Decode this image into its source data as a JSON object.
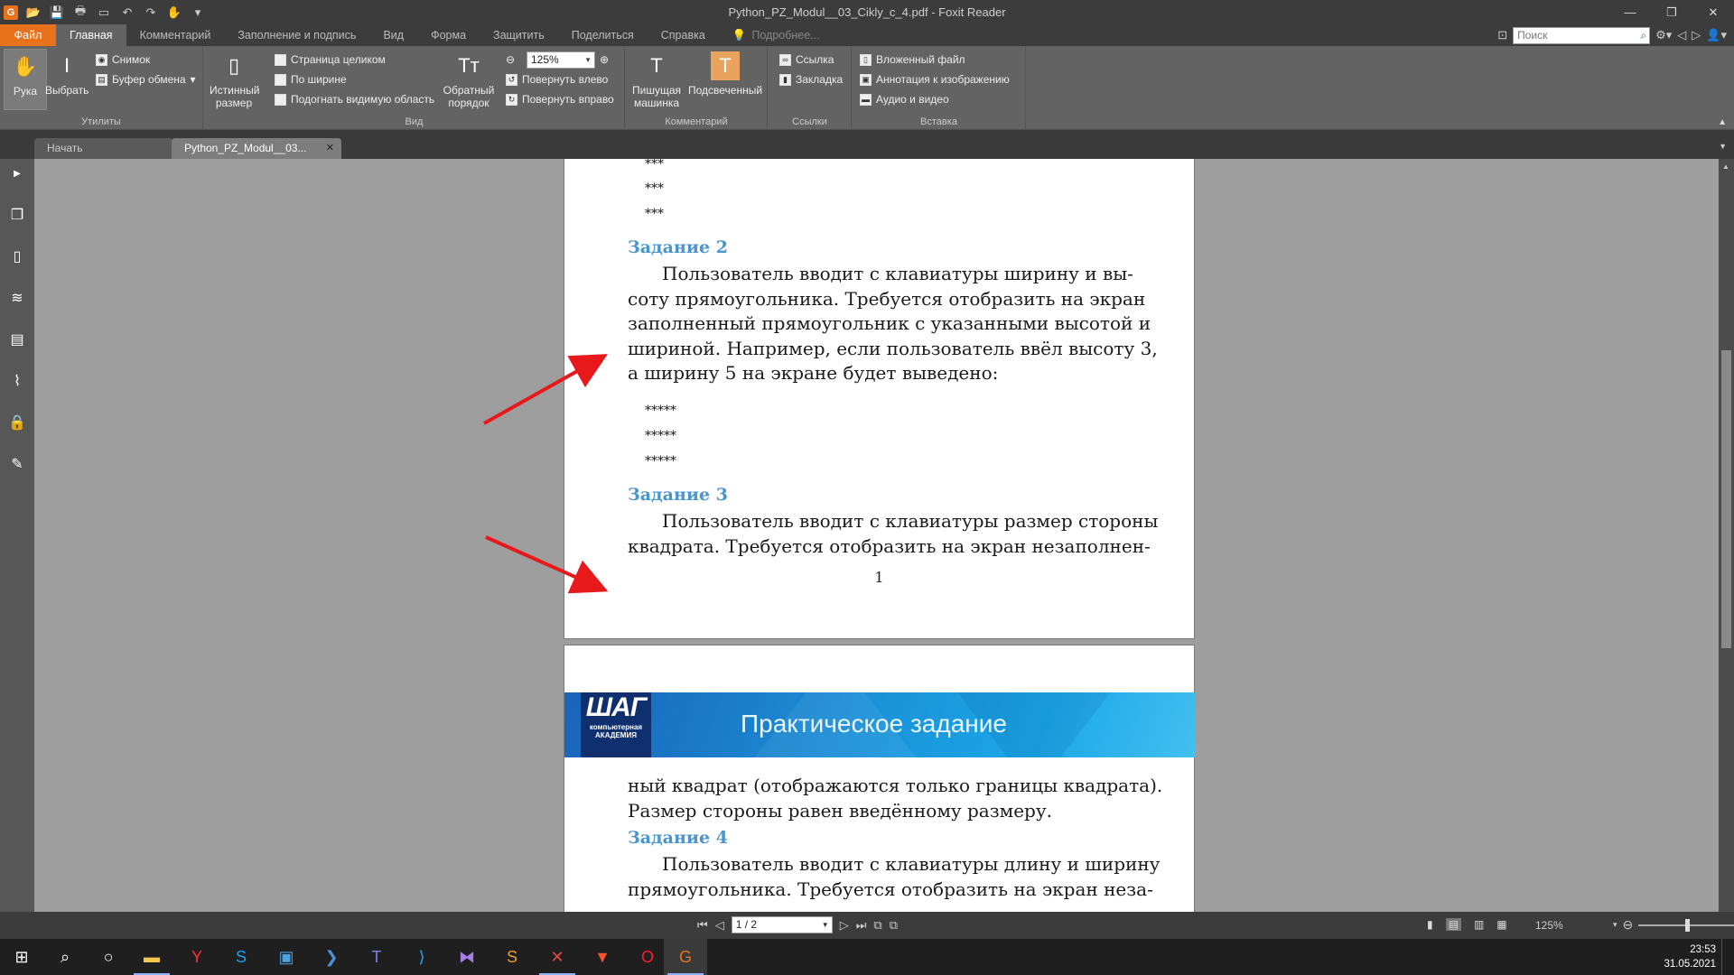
{
  "window": {
    "title": "Python_PZ_Modul__03_Cikly_c_4.pdf - Foxit Reader",
    "app_icon": "G",
    "controls": [
      "—",
      "❐",
      "✕"
    ]
  },
  "ribbon_tabs": [
    "Файл",
    "Главная",
    "Комментарий",
    "Заполнение и подпись",
    "Вид",
    "Форма",
    "Защитить",
    "Поделиться",
    "Справка"
  ],
  "tell_me": "Подробнее...",
  "search": {
    "placeholder": "Поиск"
  },
  "ribbon": {
    "utilities": {
      "label": "Утилиты",
      "hand": "Рука",
      "select": "Выбрать",
      "snapshot": "Снимок",
      "clipboard": "Буфер обмена"
    },
    "view": {
      "label": "Вид",
      "actual_size_1": "Истинный",
      "actual_size_2": "размер",
      "fit_page": "Страница целиком",
      "fit_width": "По ширине",
      "fit_visible": "Подогнать видимую область",
      "reverse_1": "Обратный",
      "reverse_2": "порядок",
      "zoom": "125%",
      "rotate_left": "Повернуть влево",
      "rotate_right": "Повернуть вправо"
    },
    "comment": {
      "label": "Комментарий",
      "typewriter_1": "Пишущая",
      "typewriter_2": "машинка",
      "highlight": "Подсвеченный"
    },
    "links": {
      "label": "Ссылки",
      "link": "Ссылка",
      "bookmark": "Закладка"
    },
    "insert": {
      "label": "Вставка",
      "attachment": "Вложенный файл",
      "image_annotation": "Аннотация к изображению",
      "audio_video": "Аудио и видео"
    }
  },
  "doc_tabs": {
    "start": "Начать",
    "current": "Python_PZ_Modul__03..."
  },
  "document": {
    "stars_top": [
      "***",
      "***",
      "***"
    ],
    "task2_heading": "Задание 2",
    "task2_lines": [
      "Пользователь вводит с клавиатуры ширину и вы-",
      "соту прямоугольника. Требуется отобразить на экран",
      "заполненный прямоугольник с указанными высотой и",
      "шириной. Например, если пользователь ввёл высоту 3,",
      "а ширину 5 на экране будет выведено:"
    ],
    "stars_mid": [
      "*****",
      "*****",
      "*****"
    ],
    "task3_heading": "Задание 3",
    "task3_lines": [
      "Пользователь вводит с клавиатуры размер стороны",
      "квадрата. Требуется отобразить на экран незаполнен-"
    ],
    "page_number": "1",
    "banner_logo_big": "ШАГ",
    "banner_logo_small1": "компьютерная",
    "banner_logo_small2": "АКАДЕМИЯ",
    "banner_title": "Практическое задание",
    "page2_lines": [
      "ный квадрат (отображаются только границы квадрата).",
      "Размер стороны равен введённому размеру."
    ],
    "task4_heading": "Задание 4",
    "task4_lines": [
      "Пользователь вводит с клавиатуры длину и ширину",
      "прямоугольника. Требуется отобразить на экран неза-"
    ],
    "heading_color": "#4a95c9",
    "arrow_color": "#e8191b"
  },
  "statusbar": {
    "page": "1 / 2",
    "zoom": "125%"
  },
  "taskbar": {
    "apps": [
      "start-icon",
      "search-icon",
      "cortana-icon",
      "explorer-icon",
      "yandex-icon",
      "skype-icon",
      "calculator-icon",
      "powershell-icon",
      "teams-icon",
      "vscode-icon",
      "visual-studio-icon",
      "sublime-icon",
      "xmind-icon",
      "brave-icon",
      "opera-icon",
      "foxit-icon"
    ],
    "time": "23:53",
    "date": "31.05.2021"
  }
}
